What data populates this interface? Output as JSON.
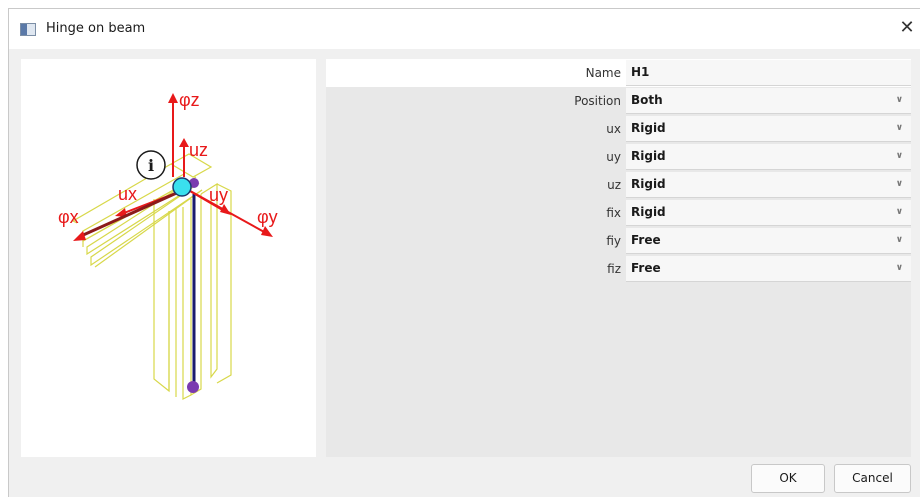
{
  "window": {
    "title": "Hinge on beam",
    "close_glyph": "✕"
  },
  "diagram": {
    "labels": {
      "phi_z": "φz",
      "uz": "uz",
      "ux": "ux",
      "uy": "uy",
      "phi_x": "φx",
      "phi_y": "φy",
      "info": "i"
    },
    "colors": {
      "arrow": "#e8191a",
      "beam_outline": "#d8d84a",
      "node": "#3ae0ee",
      "hinge_line": "#1a1a6e"
    }
  },
  "properties": [
    {
      "label": "Name",
      "value": "H1",
      "dropdown": false
    },
    {
      "label": "Position",
      "value": "Both",
      "dropdown": true
    },
    {
      "label": "ux",
      "value": "Rigid",
      "dropdown": true
    },
    {
      "label": "uy",
      "value": "Rigid",
      "dropdown": true
    },
    {
      "label": "uz",
      "value": "Rigid",
      "dropdown": true
    },
    {
      "label": "fix",
      "value": "Rigid",
      "dropdown": true
    },
    {
      "label": "fiy",
      "value": "Free",
      "dropdown": true
    },
    {
      "label": "fiz",
      "value": "Free",
      "dropdown": true
    }
  ],
  "buttons": {
    "ok": "OK",
    "cancel": "Cancel"
  }
}
